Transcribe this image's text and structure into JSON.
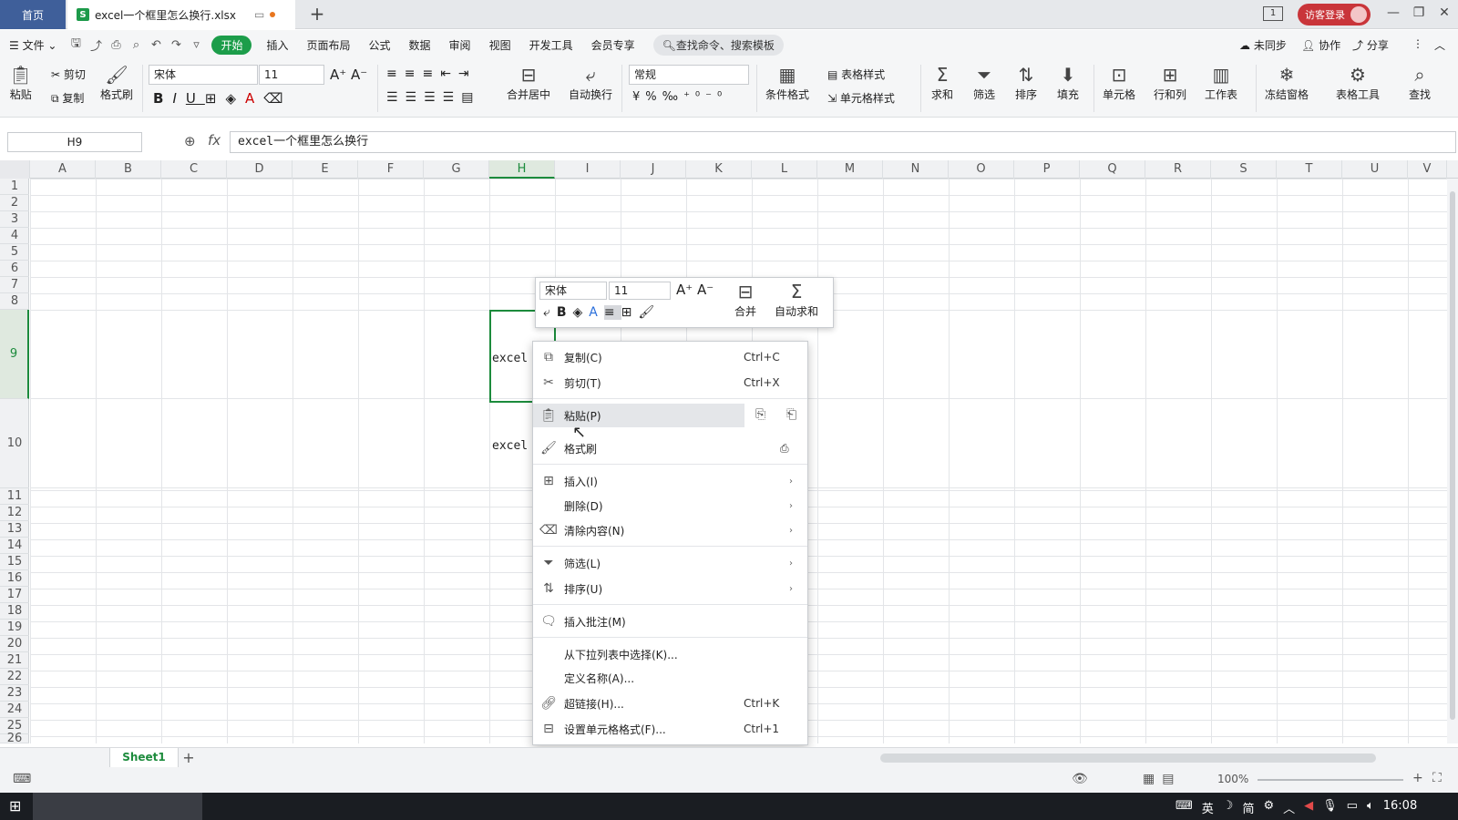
{
  "titlebar": {
    "home_tab": "首页",
    "file_tab": "excel一个框里怎么换行.xlsx",
    "new_tab": "+",
    "login": "访客登录"
  },
  "menubar": {
    "file": "文件",
    "items": [
      "开始",
      "插入",
      "页面布局",
      "公式",
      "数据",
      "审阅",
      "视图",
      "开发工具",
      "会员专享"
    ],
    "search": "查找命令、搜索模板",
    "right": [
      "未同步",
      "协作",
      "分享"
    ]
  },
  "ribbon": {
    "paste": "粘贴",
    "cut": "剪切",
    "copy": "复制",
    "format_painter": "格式刷",
    "font_name": "宋体",
    "font_size": "11",
    "number_format": "常规",
    "merge_center": "合并居中",
    "wrap": "自动换行",
    "cond_format": "条件格式",
    "table_style": "表格样式",
    "cell_style": "单元格样式",
    "sum": "求和",
    "filter": "筛选",
    "sort": "排序",
    "fill": "填充",
    "cell": "单元格",
    "row_col": "行和列",
    "worksheet": "工作表",
    "freeze": "冻结窗格",
    "table_tools": "表格工具",
    "find": "查找"
  },
  "formula": {
    "name_box": "H9",
    "fx": "fx",
    "value": "excel一个框里怎么换行"
  },
  "grid": {
    "columns": [
      "A",
      "B",
      "C",
      "D",
      "E",
      "F",
      "G",
      "H",
      "I",
      "J",
      "K",
      "L",
      "M",
      "N",
      "O",
      "P",
      "Q",
      "R",
      "S",
      "T",
      "U",
      "V"
    ],
    "rows": [
      "1",
      "2",
      "3",
      "4",
      "5",
      "6",
      "7",
      "8",
      "9",
      "10",
      "11",
      "12",
      "13",
      "14",
      "15",
      "16",
      "17",
      "18",
      "19",
      "20",
      "21",
      "22",
      "23",
      "24",
      "25",
      "26"
    ],
    "cell_h9": "excel",
    "cell_h10": "excel"
  },
  "mini_toolbar": {
    "font_name": "宋体",
    "font_size": "11",
    "merge": "合并",
    "autosum": "自动求和"
  },
  "context_menu": {
    "copy": "复制(C)",
    "copy_sc": "Ctrl+C",
    "cut": "剪切(T)",
    "cut_sc": "Ctrl+X",
    "paste": "粘贴(P)",
    "painter": "格式刷",
    "insert": "插入(I)",
    "delete": "删除(D)",
    "clear": "清除内容(N)",
    "filter": "筛选(L)",
    "sort": "排序(U)",
    "comment": "插入批注(M)",
    "dropdown": "从下拉列表中选择(K)...",
    "define_name": "定义名称(A)...",
    "hyperlink": "超链接(H)...",
    "hyperlink_sc": "Ctrl+K",
    "format_cells": "设置单元格格式(F)...",
    "format_cells_sc": "Ctrl+1"
  },
  "sheets": {
    "active": "Sheet1",
    "add": "+"
  },
  "status": {
    "zoom": "100%"
  },
  "taskbar": {
    "ime": "英",
    "ime2": "简",
    "time": "16:08"
  },
  "colors": {
    "accent": "#1c9d4a",
    "login": "#c9353a",
    "selection": "#1c8b3c"
  }
}
